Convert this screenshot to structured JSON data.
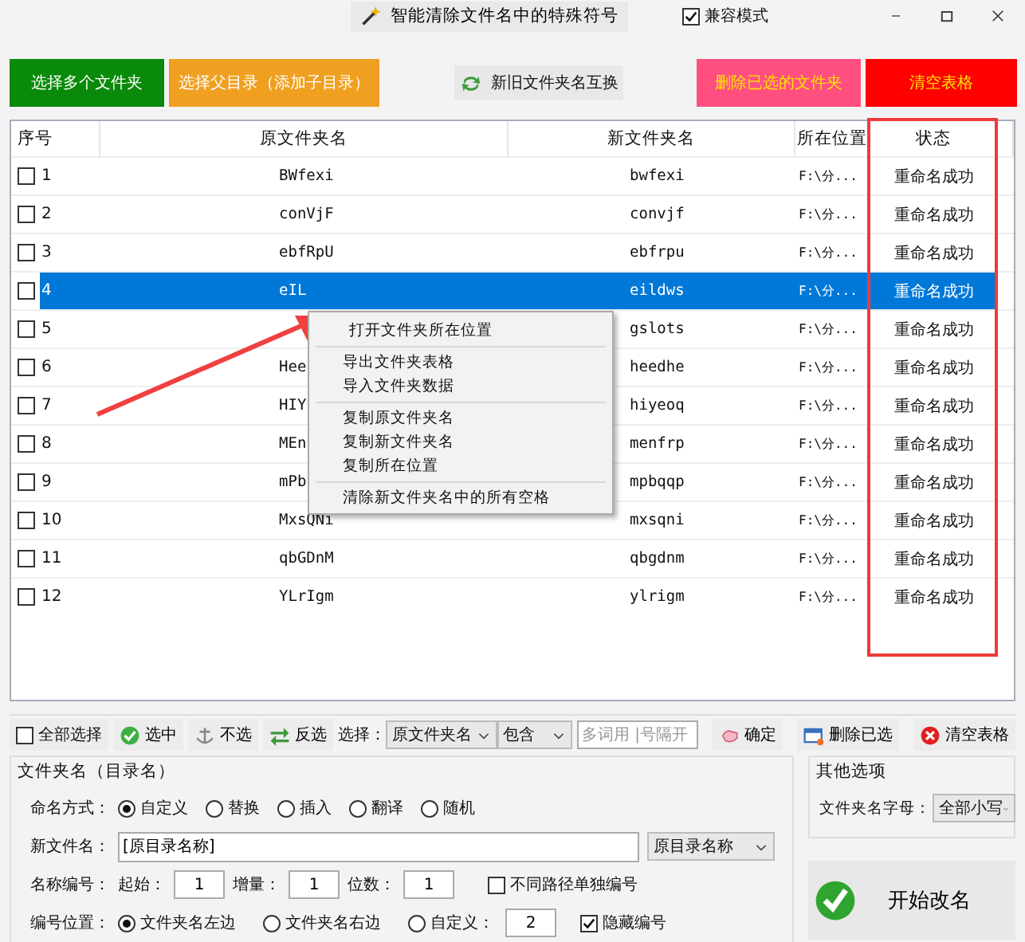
{
  "title_bar": {
    "title": "智能清除文件名中的特殊符号",
    "compat": {
      "label": "兼容模式",
      "checked": true
    }
  },
  "top_buttons": [
    {
      "label": "选择多个文件夹",
      "kind": "green"
    },
    {
      "label": "选择父目录（添加子目录）",
      "kind": "orange"
    },
    {
      "label": "新旧文件夹名互换",
      "kind": "swap"
    },
    {
      "label": "删除已选的文件夹",
      "kind": "pink"
    },
    {
      "label": "清空表格",
      "kind": "red"
    }
  ],
  "table": {
    "columns": [
      "序号",
      "原文件夹名",
      "新文件夹名",
      "所在位置",
      "状态"
    ],
    "rows": [
      {
        "checked": false,
        "selected": false,
        "number": "1",
        "original": "BWfexi",
        "new": "bwfexi",
        "location": "F:\\分...",
        "status": "重命名成功"
      },
      {
        "checked": false,
        "selected": false,
        "number": "2",
        "original": "conVjF",
        "new": "convjf",
        "location": "F:\\分...",
        "status": "重命名成功"
      },
      {
        "checked": false,
        "selected": false,
        "number": "3",
        "original": "ebfRpU",
        "new": "ebfrpu",
        "location": "F:\\分...",
        "status": "重命名成功"
      },
      {
        "checked": false,
        "selected": true,
        "number": "4",
        "original": "eIL",
        "new": "eildws",
        "location": "F:\\分...",
        "status": "重命名成功"
      },
      {
        "checked": false,
        "selected": false,
        "number": "5",
        "new": "gslots",
        "location": "F:\\分...",
        "status": "重命名成功"
      },
      {
        "checked": false,
        "selected": false,
        "number": "6",
        "original": "Hee",
        "new": "heedhe",
        "location": "F:\\分...",
        "status": "重命名成功"
      },
      {
        "checked": false,
        "selected": false,
        "number": "7",
        "original": "HIY",
        "new": "hiyeoq",
        "location": "F:\\分...",
        "status": "重命名成功"
      },
      {
        "checked": false,
        "selected": false,
        "number": "8",
        "original": "MEn",
        "new": "menfrp",
        "location": "F:\\分...",
        "status": "重命名成功"
      },
      {
        "checked": false,
        "selected": false,
        "number": "9",
        "original": "mPb",
        "new": "mpbqqp",
        "location": "F:\\分...",
        "status": "重命名成功"
      },
      {
        "checked": false,
        "selected": false,
        "number": "10",
        "original": "MxsQNi",
        "new": "mxsqni",
        "location": "F:\\分...",
        "status": "重命名成功"
      },
      {
        "checked": false,
        "selected": false,
        "number": "11",
        "original": "qbGDnM",
        "new": "qbgdnm",
        "location": "F:\\分...",
        "status": "重命名成功"
      },
      {
        "checked": false,
        "selected": false,
        "number": "12",
        "original": "YLrIgm",
        "new": "ylrigm",
        "location": "F:\\分...",
        "status": "重命名成功"
      }
    ]
  },
  "context_menu": {
    "sections": [
      {
        "items": [
          "打开文件夹所在位置"
        ]
      },
      {
        "items": [
          "导出文件夹表格",
          "导入文件夹数据"
        ]
      },
      {
        "items": [
          "复制原文件夹名",
          "复制新文件夹名",
          "复制所在位置"
        ]
      },
      {
        "items": [
          "清除新文件夹名中的所有空格"
        ]
      }
    ]
  },
  "toolbar": {
    "select_all": {
      "label": "全部选择",
      "checked": false
    },
    "left_buttons": [
      {
        "label": "选中",
        "kind": "check"
      },
      {
        "label": "不选",
        "kind": "anchor"
      },
      {
        "label": "反选",
        "kind": "swap"
      }
    ],
    "select_label": "选择：",
    "field_dropdown": "原文件夹名",
    "match_dropdown": "包含",
    "keyword_placeholder": "多词用 |号隔开",
    "right_buttons": [
      {
        "label": "确定",
        "kind": "pointer"
      },
      {
        "label": "删除已选",
        "kind": "window"
      },
      {
        "label": "清空表格",
        "kind": "clear"
      }
    ]
  },
  "naming": {
    "title": "文件夹名（目录名）",
    "mode": {
      "label": "命名方式：",
      "options": [
        {
          "label": "自定义",
          "selected": true
        },
        {
          "label": "替换",
          "selected": false
        },
        {
          "label": "插入",
          "selected": false
        },
        {
          "label": "翻译",
          "selected": false
        },
        {
          "label": "随机",
          "selected": false
        }
      ]
    },
    "new_name": {
      "label": "新文件名：",
      "value": "[原目录名称]",
      "dropdown": "原目录名称"
    },
    "numbering": {
      "label": "名称编号：",
      "start_label": "起始：",
      "start": "1",
      "step_label": "增量：",
      "step": "1",
      "digits_label": "位数：",
      "digits": "1",
      "separate": {
        "label": "不同路径单独编号",
        "checked": false
      }
    },
    "position": {
      "label": "编号位置：",
      "options": [
        {
          "label": "文件夹名左边",
          "selected": true
        },
        {
          "label": "文件夹名右边",
          "selected": false
        },
        {
          "label": "自定义：",
          "selected": false
        }
      ],
      "custom": "2",
      "hide": {
        "label": "隐藏编号",
        "checked": true
      }
    }
  },
  "other_options": {
    "title": "其他选项",
    "label": "文件夹名字母：",
    "dropdown": "全部小写"
  },
  "start_button": {
    "label": "开始改名"
  }
}
